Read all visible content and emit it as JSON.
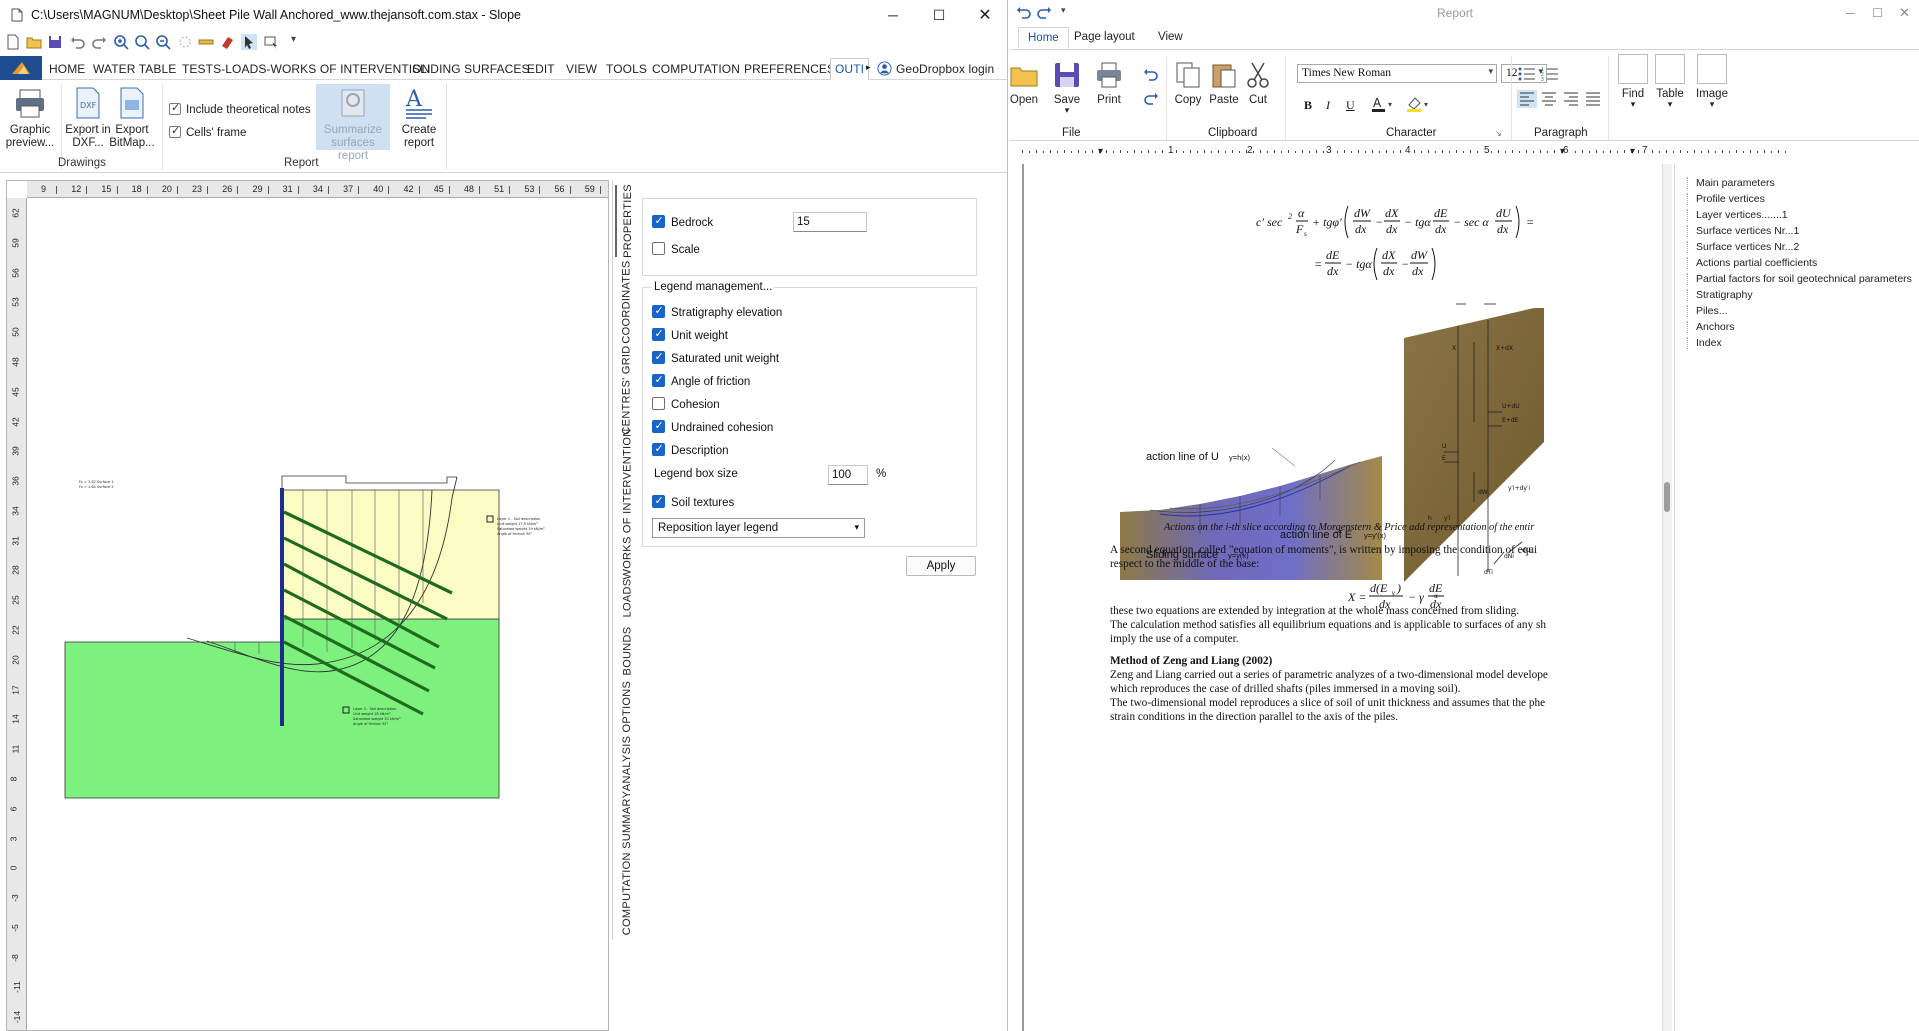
{
  "slope": {
    "title": "C:\\Users\\MAGNUM\\Desktop\\Sheet Pile Wall Anchored_www.thejansoft.com.stax - Slope",
    "menu": [
      "HOME",
      "WATER TABLE",
      "TESTS-LOADS-WORKS OF INTERVENTION",
      "SLIDING SURFACES",
      "EDIT",
      "VIEW",
      "TOOLS",
      "COMPUTATION",
      "PREFERENCES",
      "OUTI"
    ],
    "geodropbox": "GeoDropbox login",
    "ribbon": {
      "graphic_preview": "Graphic preview...",
      "export_dxf": "Export in DXF...",
      "export_bitmap": "Export BitMap...",
      "include_theoretical": "Include theoretical notes",
      "cells_frame": "Cells' frame",
      "summarize": "Summarize surfaces report",
      "create_report": "Create report",
      "group_drawings": "Drawings",
      "group_report": "Report"
    },
    "hruler_ticks": [
      "9",
      "12",
      "15",
      "18",
      "20",
      "23",
      "26",
      "29",
      "31",
      "34",
      "37",
      "40",
      "42",
      "45",
      "48",
      "51",
      "53",
      "56",
      "59"
    ],
    "vruler_ticks": [
      "62",
      "59",
      "56",
      "53",
      "50",
      "48",
      "45",
      "42",
      "39",
      "36",
      "34",
      "31",
      "28",
      "25",
      "22",
      "20",
      "17",
      "14",
      "11",
      "8",
      "6",
      "3",
      "0",
      "-3",
      "-5",
      "-8",
      "-11",
      "-14"
    ],
    "vtabs": [
      "PROPERTIES",
      "COORDINATES",
      "CENTRES' GRID",
      "WORKS OF INTERVENTION",
      "LOADS",
      "BOUNDS",
      "ANALYSIS OPTIONS",
      "COMPUTATION SUMMARY"
    ],
    "props": {
      "bedrock": "Bedrock",
      "bedrock_value": "15",
      "scale": "Scale",
      "legend_title": "Legend management...",
      "stratigraphy": "Stratigraphy elevation",
      "unit_weight": "Unit weight",
      "sat_unit_weight": "Saturated unit weight",
      "angle_friction": "Angle of friction",
      "cohesion": "Cohesion",
      "undrained": "Undrained cohesion",
      "description": "Description",
      "legend_box": "Legend box size",
      "legend_box_value": "100",
      "percent": "%",
      "soil_textures": "Soil textures",
      "reposition": "Reposition layer legend",
      "apply": "Apply"
    }
  },
  "report": {
    "title": "Report",
    "tabs": [
      "Home",
      "Page layout",
      "View"
    ],
    "ribbon": {
      "open": "Open",
      "save": "Save",
      "print": "Print",
      "copy": "Copy",
      "paste": "Paste",
      "cut": "Cut",
      "font": "Times New Roman",
      "size": "12",
      "find": "Find",
      "table": "Table",
      "image": "Image",
      "g_file": "File",
      "g_clipboard": "Clipboard",
      "g_character": "Character",
      "g_paragraph": "Paragraph"
    },
    "ruler_ticks": [
      "1",
      "2",
      "3",
      "4",
      "5",
      "6",
      "7"
    ],
    "tree": [
      "Main parameters",
      "Profile vertices",
      "Layer vertices.......1",
      "Surface vertices Nr...1",
      "Surface vertices Nr...2",
      "Actions partial coefficients",
      "Partial factors for soil geotechnical parameters",
      "Stratigraphy",
      "Piles...",
      "Anchors",
      "Index"
    ],
    "doc": {
      "fig_action_u": "action line of U",
      "fig_action_u_eq": "y=h(x)",
      "fig_action_e": "action line of E",
      "fig_action_e_eq": "y=y'(x)",
      "fig_sliding": "Sliding surface",
      "fig_sliding_eq": "y=y(x)",
      "caption": "Actions on the i-th slice according to Morgenstern & Price add representation of the entir",
      "p1a": "A second equation, called \"equation of moments\", is written by imposing the condition of equi",
      "p1b": "respect to the middle of the base:",
      "p2": "these two equations are extended by integration at the whole mass concerned from sliding.",
      "p3a": "The calculation method satisfies all equilibrium equations and is applicable to surfaces of any sh",
      "p3b": "imply the use of a computer.",
      "h1": "Method of Zeng and Liang (2002)",
      "p4a": "Zeng and Liang carried out a series of parametric analyzes of a two-dimensional model develope",
      "p4b": "which reproduces the case of drilled shafts (piles immersed in a moving soil).",
      "p5a": "The two-dimensional model reproduces a slice of soil of unit thickness and assumes that the phe",
      "p5b": "strain conditions in the direction parallel to the axis of the piles."
    }
  },
  "colors": {
    "accent": "#1964c8",
    "soil_upper": "#fbfbc4",
    "soil_lower": "#7df07d",
    "anchor": "#1e6b1e",
    "wall": "#1d2c8f",
    "app_blue": "#1e4d8f"
  }
}
